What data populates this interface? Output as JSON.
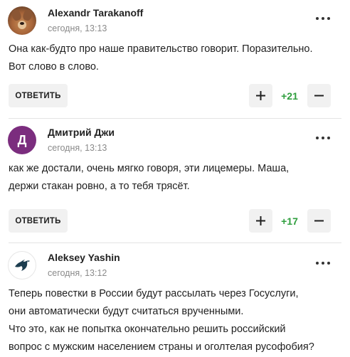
{
  "comments": [
    {
      "author": "Alexandr Tarakanoff",
      "time": "сегодня, 13:13",
      "avatar": "dog-photo",
      "text_lines": [
        "Она как-будто про наше правительство говорит. Поразительно.",
        "Вот слово в слово."
      ],
      "reply_label": "ОТВЕТИТЬ",
      "score": "+21",
      "score_color": "#2e9e3d"
    },
    {
      "author": "Дмитрий Джи",
      "time": "сегодня, 13:13",
      "avatar_letter": "Д",
      "avatar_color": "#7b2d7e",
      "text_lines": [
        "как же достали, очень мягко говоря, эти лицемеры. Маша,",
        "держи стакан ровно, а то тебя трясёт."
      ],
      "reply_label": "ОТВЕТИТЬ",
      "score": "+17",
      "score_color": "#2e9e3d"
    },
    {
      "author": "Aleksey Yashin",
      "time": "сегодня, 13:12",
      "avatar": "bird-logo",
      "text_lines": [
        "Теперь повестки в России будут рассылать через Госуслуги,",
        "они автоматически будут считаться врученными.",
        "Что это, как не попытка окончательно решить российский",
        "вопрос с мужским населением страны и оголтелая русофобия?"
      ]
    }
  ],
  "icons": {
    "more": "more-dots-icon",
    "plus": "plus-icon",
    "minus": "minus-icon"
  }
}
